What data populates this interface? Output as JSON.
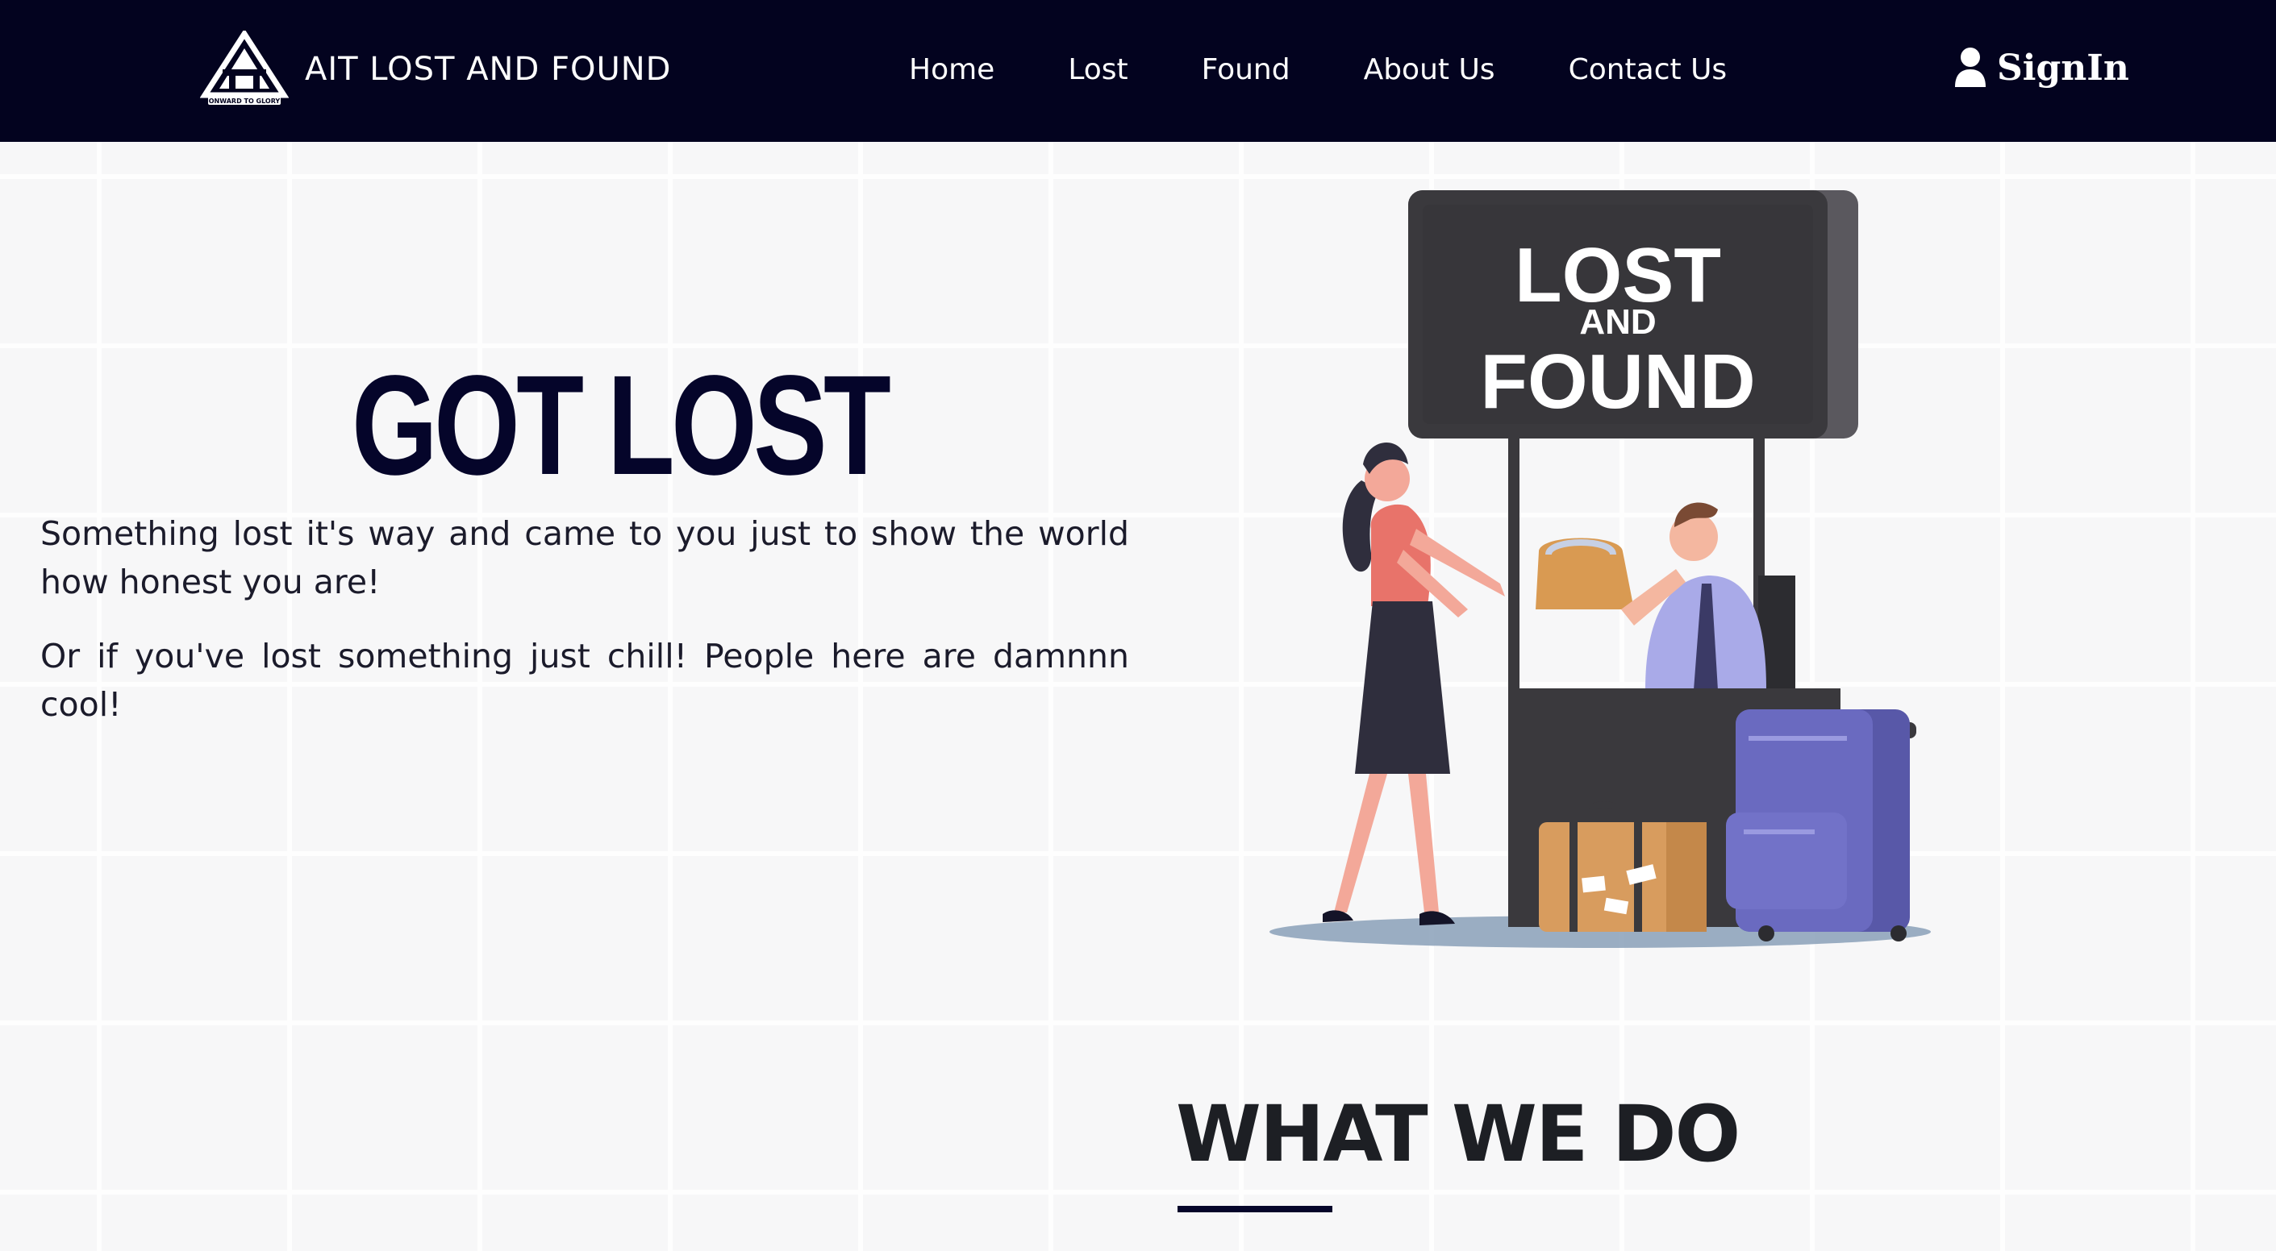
{
  "navbar": {
    "brand_text": "AIT LOST AND FOUND",
    "brand_logo_icon": "ait-triangle-logo",
    "links": [
      {
        "label": "Home"
      },
      {
        "label": "Lost"
      },
      {
        "label": "Found"
      },
      {
        "label": "About Us"
      },
      {
        "label": "Contact Us"
      }
    ],
    "signin_label": "SignIn",
    "signin_icon": "user-icon",
    "background_color": "#03031f"
  },
  "hero": {
    "title": "GOT LOST",
    "paragraphs": [
      "Something lost it's way and came to you just to show the world how honest you are!",
      "Or if you've lost something just chill! People here are damnnn cool!"
    ],
    "illustration": {
      "sign_line1": "LOST",
      "sign_line2": "AND",
      "sign_line3": "FOUND"
    },
    "title_color": "#05052a"
  },
  "section": {
    "title": "WHAT WE DO"
  }
}
